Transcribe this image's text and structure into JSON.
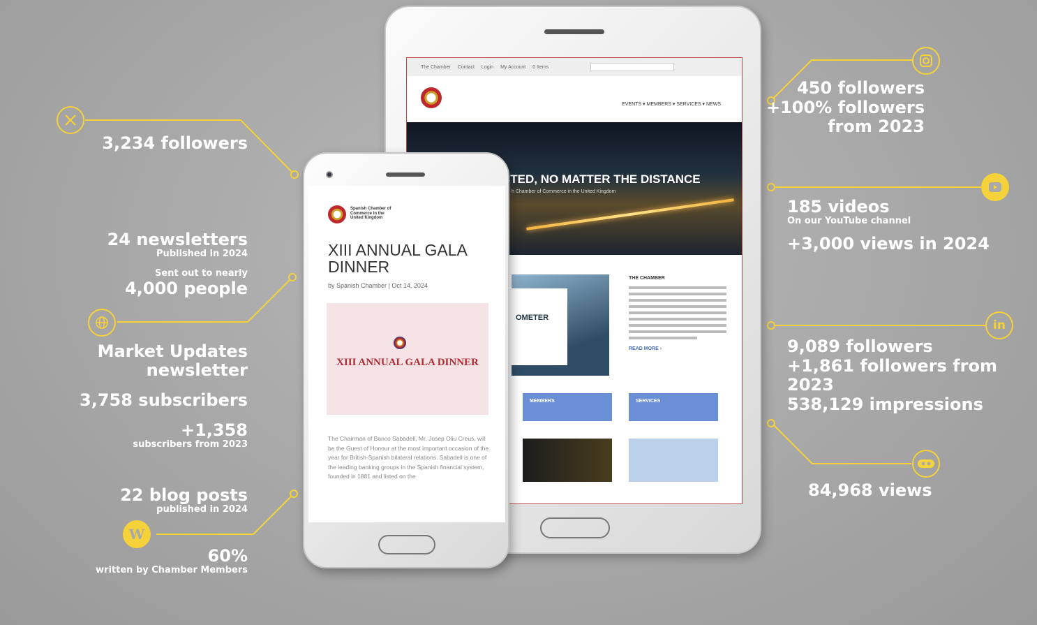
{
  "twitter": {
    "followers": "3,234 followers"
  },
  "newsletters": {
    "count": "24 newsletters",
    "published": "Published in 2024",
    "sent_out": "Sent out to nearly",
    "people": "4,000 people"
  },
  "market_updates": {
    "title": "Market Updates newsletter",
    "subscribers": "3,758 subscribers",
    "growth": "+1,358",
    "growth_label": "subscribers from 2023"
  },
  "blog": {
    "posts": "22 blog posts",
    "published": "published in 2024",
    "percent": "60%",
    "written_by": "written by Chamber Members"
  },
  "instagram": {
    "followers": "450 followers",
    "growth": "+100% followers",
    "from": "from 2023"
  },
  "youtube": {
    "videos": "185 videos",
    "channel": "On our YouTube channel",
    "views": "+3,000 views in 2024"
  },
  "linkedin": {
    "followers": "9,089 followers",
    "growth": "+1,861 followers from 2023",
    "impressions": "538,129 impressions"
  },
  "flickr": {
    "views": "84,968 views"
  },
  "tablet": {
    "topbar": [
      "The Chamber",
      "Contact",
      "Login",
      "My Account",
      "0 Items"
    ],
    "nav": "EVENTS ▾   MEMBERS ▾   SERVICES ▾   NEWS",
    "hero_title": "CTED, NO MATTER THE DISTANCE",
    "hero_sub": "h Chamber of Commerce in the United Kingdom",
    "card_text": "OMETER",
    "chamber_heading": "THE CHAMBER",
    "read_more": "READ MORE ›",
    "members": "MEMBERS",
    "services": "SERVICES"
  },
  "phone": {
    "logo_text": "Spanish Chamber of Commerce in the United Kingdom",
    "title": "XIII ANNUAL GALA DINNER",
    "byline": "by Spanish Chamber | Oct 14, 2024",
    "invite_title": "XIII ANNUAL GALA DINNER",
    "body": "The Chairman of Banco Sabadell, Mr. Josep Oliu Creus, will be the Guest of Honour at the most important occasion of the year for British-Spanish bilateral relations. Sabadell is one of the leading banking groups in the Spanish financial system, founded in 1881 and listed on the"
  },
  "colors": {
    "accent": "#f6d23a",
    "background": "#a9a9a9"
  }
}
